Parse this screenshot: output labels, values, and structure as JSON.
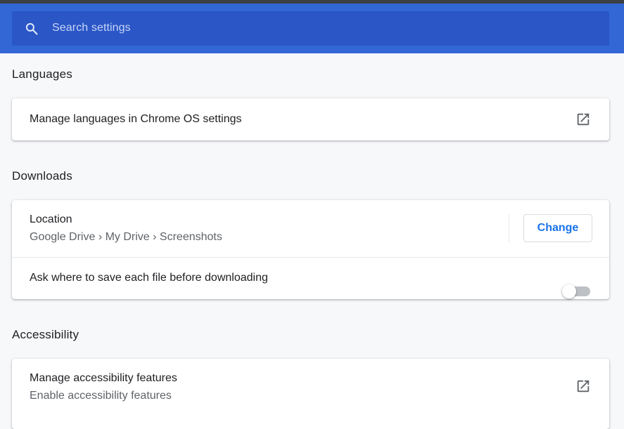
{
  "search": {
    "placeholder": "Search settings",
    "icon": "search-icon"
  },
  "languages": {
    "title": "Languages",
    "manage_label": "Manage languages in Chrome OS settings",
    "icon": "external-link-icon"
  },
  "downloads": {
    "title": "Downloads",
    "location_label": "Location",
    "location_path": "Google Drive › My Drive › Screenshots",
    "change_label": "Change",
    "ask_label": "Ask where to save each file before downloading",
    "ask_enabled": false
  },
  "accessibility": {
    "title": "Accessibility",
    "manage_label": "Manage accessibility features",
    "manage_sub": "Enable accessibility features",
    "icon": "external-link-icon"
  },
  "colors": {
    "header_bg": "#3367d6",
    "search_bg": "#2a56c6",
    "accent": "#1a73e8",
    "page_bg": "#f7f8fa"
  }
}
